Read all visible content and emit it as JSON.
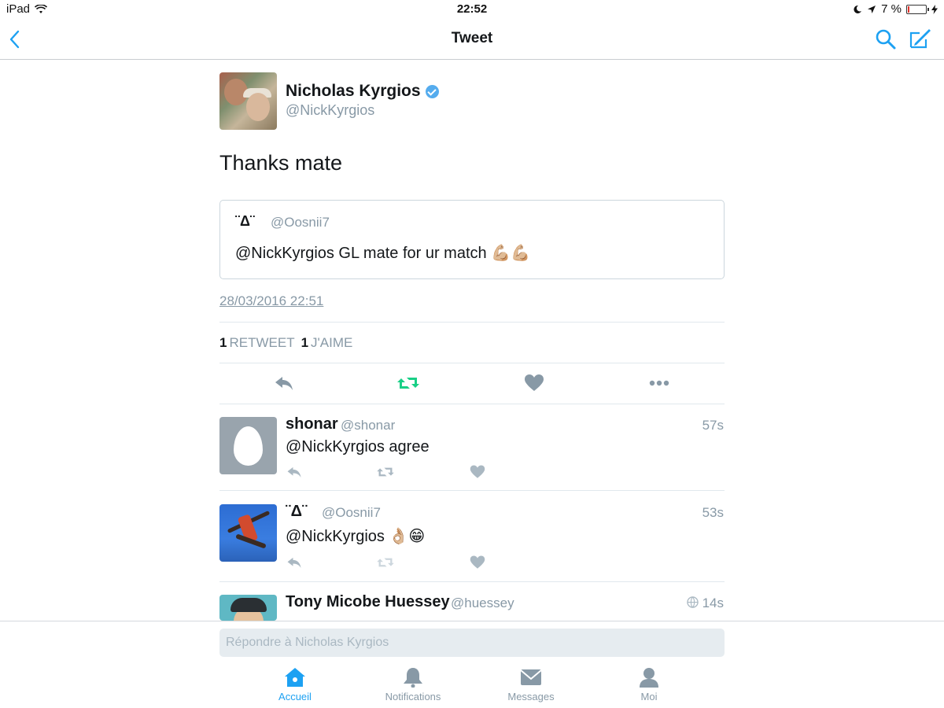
{
  "status_bar": {
    "device": "iPad",
    "time": "22:52",
    "battery": "7 %",
    "battery_level": 0.07,
    "battery_color": "#e0332b"
  },
  "nav": {
    "title": "Tweet",
    "accent": "#1da1f2"
  },
  "tweet": {
    "name": "Nicholas Kyrgios",
    "handle": "@NickKyrgios",
    "verified": true,
    "text": "Thanks mate",
    "quote": {
      "name": "¨Δ¨",
      "handle": "@Oosnii7",
      "text": "@NickKyrgios GL mate for ur match 💪🏼💪🏼"
    },
    "timestamp": "28/03/2016 22:51",
    "retweets": "1",
    "retweet_label": "RETWEET",
    "likes": "1",
    "likes_label": "J'AIME",
    "retweeted_color": "#19cf86"
  },
  "replies": [
    {
      "name": "shonar",
      "handle": "@shonar",
      "time": "57s",
      "text": "@NickKyrgios agree",
      "avatar": "egg-avatar"
    },
    {
      "name": "¨Δ¨",
      "handle": "@Oosnii7",
      "time": "53s",
      "text": "@NickKyrgios 👌🏼😁",
      "avatar": "tennis-player-avatar"
    },
    {
      "name": "Tony Micobe Huessey",
      "handle": "@huessey",
      "time": "14s",
      "avatar": "cartoon-avatar"
    }
  ],
  "compose": {
    "placeholder": "Répondre à Nicholas Kyrgios"
  },
  "tabs": [
    {
      "label": "Accueil",
      "icon": "home-icon",
      "active": true
    },
    {
      "label": "Notifications",
      "icon": "bell-icon",
      "active": false
    },
    {
      "label": "Messages",
      "icon": "envelope-icon",
      "active": false
    },
    {
      "label": "Moi",
      "icon": "person-icon",
      "active": false
    }
  ]
}
